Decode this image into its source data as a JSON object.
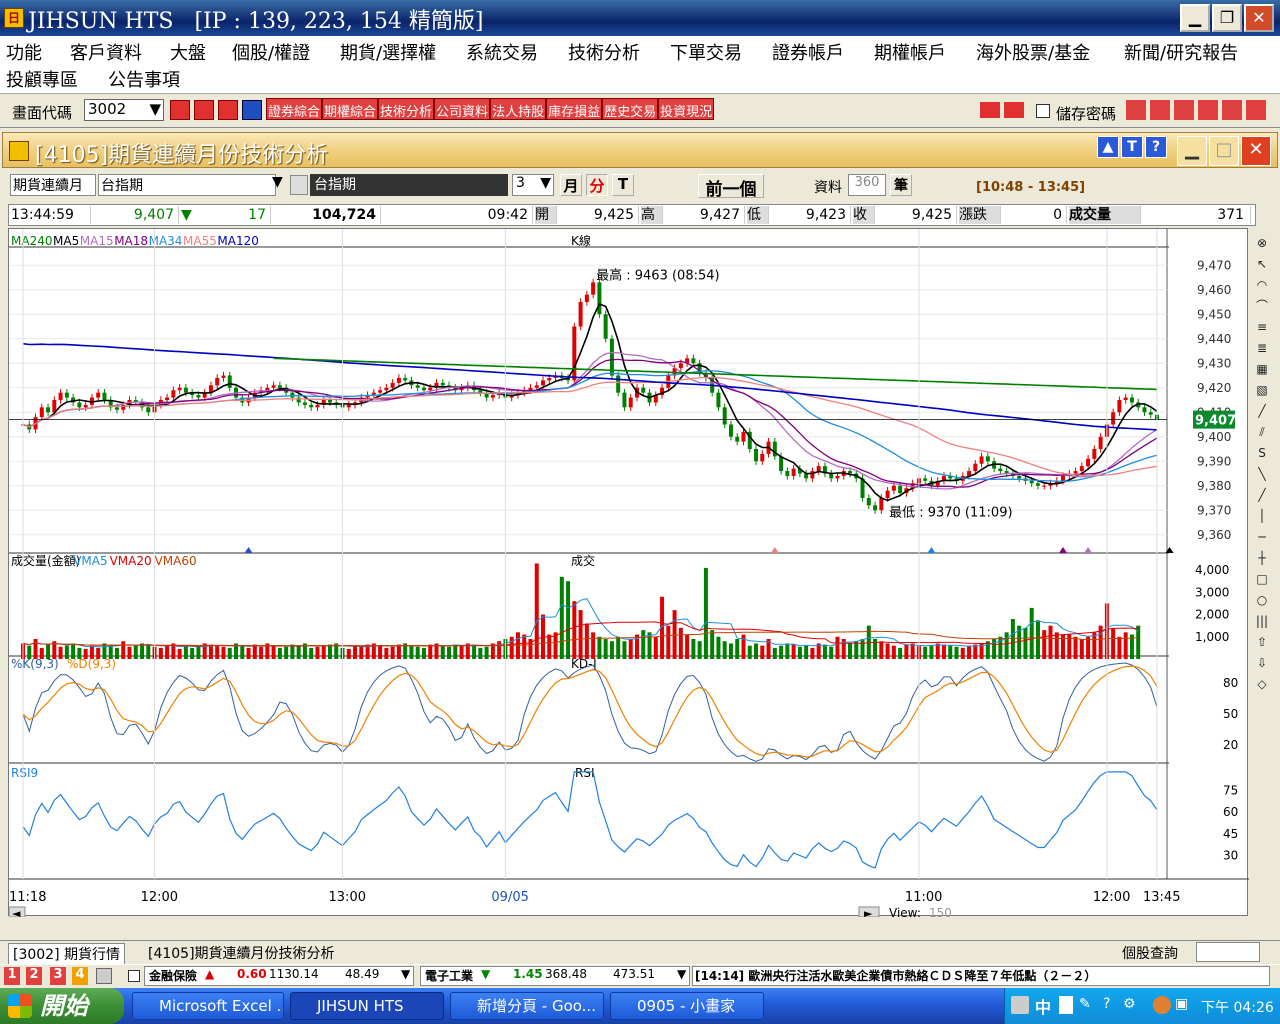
{
  "window": {
    "title": "JIHSUN HTS",
    "ip": "[IP : 139, 223, 154 精簡版]",
    "minimize": "▁",
    "maximize": "❐",
    "close": "✕"
  },
  "menu": {
    "row1": [
      "功能",
      "客戶資料",
      "大盤",
      "個股/權證",
      "期貨/選擇權",
      "系統交易",
      "技術分析",
      "下單交易",
      "證券帳戶",
      "期權帳戶",
      "海外股票/基金",
      "新聞/研究報告"
    ],
    "row2": [
      "投顧專區",
      "公告事項"
    ]
  },
  "toolbar": {
    "code_label": "畫面代碼",
    "code_value": "3002",
    "shortcuts": [
      "證券綜合",
      "期權綜合",
      "技術分析",
      "公司資料",
      "法人持股",
      "庫存損益",
      "歷史交易",
      "投資現況"
    ],
    "save_password_label": "儲存密碼"
  },
  "inner": {
    "caption": "[4105]期貨連續月份技術分析",
    "help_buttons": [
      "▲",
      "T",
      "?"
    ]
  },
  "controls": {
    "product_type": "期貨連續月",
    "product_name": "台指期",
    "selected_name": "台指期",
    "period_value": "3",
    "month_btn": "月",
    "minute_btn": "分",
    "tick_btn": "T",
    "prev_btn": "前一個",
    "data_label": "資料",
    "data_value": "360",
    "unit_label": "筆",
    "time_range": "[10:48 - 13:45]"
  },
  "quote": {
    "time": "13:44:59",
    "price": "9,407",
    "arrow": "▼",
    "change": "17",
    "volume_total": "104,724",
    "last_time": "09:42",
    "open_label": "開",
    "open": "9,425",
    "high_label": "高",
    "high": "9,427",
    "low_label": "低",
    "low": "9,423",
    "close_label": "收",
    "close": "9,425",
    "updown_label": "漲跌",
    "updown": "0",
    "vol_label": "成交量",
    "vol": "371"
  },
  "colors": {
    "up": "#e00000",
    "down": "#008000",
    "ma5": "#000000",
    "ma15": "#b070c0",
    "ma18": "#800080",
    "ma34": "#1e8fe0",
    "ma55": "#f08080",
    "ma120": "#0000c0",
    "ma240": "#008000",
    "k": "#3060a0",
    "d": "#f08000",
    "rsi": "#2080e0"
  },
  "chart_data": [
    {
      "type": "line",
      "title": "K線",
      "legend": [
        "MA240",
        "MA5",
        "MA15",
        "MA18",
        "MA34",
        "MA55",
        "MA120"
      ],
      "y_ticks": [
        9470,
        9460,
        9450,
        9440,
        9430,
        9420,
        9410,
        9400,
        9390,
        9380,
        9370,
        9360
      ],
      "ylim": [
        9355,
        9475
      ],
      "current_value": "9,407",
      "annotations": {
        "high": "最高 : 9463 (08:54)",
        "low": "最低 : 9370 (11:09)"
      },
      "close": [
        9405,
        9403,
        9408,
        9412,
        9410,
        9415,
        9418,
        9416,
        9414,
        9412,
        9413,
        9416,
        9418,
        9415,
        9412,
        9411,
        9413,
        9415,
        9414,
        9412,
        9410,
        9413,
        9415,
        9416,
        9419,
        9420,
        9418,
        9417,
        9416,
        9418,
        9421,
        9424,
        9425,
        9420,
        9416,
        9414,
        9416,
        9418,
        9419,
        9420,
        9421,
        9420,
        9418,
        9416,
        9414,
        9413,
        9412,
        9413,
        9415,
        9414,
        9413,
        9412,
        9413,
        9414,
        9416,
        9417,
        9418,
        9419,
        9420,
        9422,
        9424,
        9423,
        9421,
        9420,
        9419,
        9420,
        9422,
        9421,
        9420,
        9419,
        9420,
        9421,
        9419,
        9418,
        9416,
        9417,
        9418,
        9416,
        9417,
        9418,
        9419,
        9420,
        9421,
        9423,
        9424,
        9425,
        9424,
        9423,
        9445,
        9455,
        9458,
        9463,
        9450,
        9440,
        9425,
        9418,
        9412,
        9416,
        9420,
        9418,
        9414,
        9417,
        9420,
        9425,
        9428,
        9430,
        9432,
        9430,
        9426,
        9424,
        9418,
        9412,
        9405,
        9400,
        9398,
        9402,
        9395,
        9390,
        9393,
        9398,
        9392,
        9386,
        9384,
        9387,
        9385,
        9383,
        9386,
        9388,
        9385,
        9383,
        9384,
        9386,
        9385,
        9383,
        9375,
        9372,
        9370,
        9375,
        9378,
        9380,
        9377,
        9379,
        9381,
        9383,
        9382,
        9380,
        9382,
        9384,
        9383,
        9382,
        9384,
        9386,
        9389,
        9392,
        9390,
        9387,
        9386,
        9385,
        9384,
        9383,
        9382,
        9381,
        9380,
        9380,
        9381,
        9382,
        9384,
        9385,
        9386,
        9388,
        9391,
        9395,
        9400,
        9405,
        9410,
        9415,
        9416,
        9414,
        9412,
        9410,
        9409,
        9407
      ]
    },
    {
      "type": "bar",
      "title": "成交",
      "legend": [
        "成交量(金額)",
        "VMA5",
        "VMA20",
        "VMA60"
      ],
      "y_ticks": [
        4000,
        3000,
        2000,
        1000
      ],
      "ylim": [
        0,
        4500
      ],
      "values": [
        700,
        600,
        900,
        500,
        650,
        800,
        550,
        600,
        700,
        500,
        450,
        600,
        500,
        700,
        650,
        500,
        800,
        550,
        600,
        700,
        650,
        550,
        500,
        600,
        700,
        450,
        600,
        500,
        550,
        700,
        650,
        600,
        550,
        500,
        700,
        600,
        500,
        650,
        550,
        700,
        600,
        500,
        550,
        650,
        600,
        700,
        500,
        550,
        600,
        650,
        700,
        500,
        450,
        600,
        550,
        650,
        700,
        600,
        500,
        550,
        650,
        700,
        600,
        550,
        500,
        650,
        700,
        600,
        550,
        650,
        600,
        700,
        650,
        500,
        550,
        700,
        800,
        900,
        1000,
        1200,
        1100,
        900,
        4300,
        2000,
        1100,
        1200,
        3700,
        3500,
        2600,
        2200,
        1600,
        1200,
        1000,
        900,
        800,
        1000,
        800,
        900,
        1100,
        1300,
        1200,
        1000,
        2800,
        1500,
        2200,
        1400,
        1100,
        900,
        800,
        4100,
        1300,
        1000,
        800,
        700,
        900,
        1100,
        600,
        700,
        600,
        900,
        500,
        600,
        700,
        650,
        550,
        600,
        500,
        700,
        650,
        550,
        1000,
        900,
        700,
        800,
        900,
        1500,
        900,
        800,
        700,
        600,
        500,
        650,
        700,
        600,
        550,
        600,
        700,
        650,
        600,
        550,
        500,
        600,
        650,
        700,
        800,
        900,
        1000,
        1200,
        1800,
        1500,
        1400,
        2300,
        1700,
        1300,
        1500,
        1200,
        1100,
        1100,
        1000,
        900,
        1000,
        1200,
        1500,
        2500,
        1400,
        1000,
        1200,
        1100,
        1500
      ]
    },
    {
      "type": "line",
      "title": "KD-J",
      "legend": [
        "%K(9,3)",
        "%D(9,3)"
      ],
      "y_ticks": [
        80,
        50,
        20
      ],
      "ylim": [
        0,
        100
      ]
    },
    {
      "type": "line",
      "title": "RSI",
      "legend": [
        "RSI9"
      ],
      "y_ticks": [
        75,
        60,
        45,
        30
      ],
      "ylim": [
        15,
        90
      ]
    }
  ],
  "xaxis": {
    "labels": [
      "11:18",
      "12:00",
      "13:00",
      "09/05",
      "11:00",
      "12:00",
      "13:00",
      "13:45"
    ]
  },
  "scroll": {
    "view_label": "View:",
    "view_value": "150",
    "left": "◄",
    "right": "►"
  },
  "tabs": {
    "tab1": "[3002] 期貨行情",
    "tab2": "[4105]期貨連續月份技術分析",
    "stock_query": "個股查詢"
  },
  "ticker": {
    "nums": [
      "1",
      "2",
      "3",
      "4"
    ],
    "item1_name": "金融保險",
    "item1_arrow": "▲",
    "item1_chg": "0.60",
    "item1_price": "1130.14",
    "item1_vol": "48.49",
    "item2_name": "電子工業",
    "item2_arrow": "▼",
    "item2_chg": "1.45",
    "item2_price": "368.48",
    "item2_vol": "473.51",
    "news": "[14:14] 歐洲央行注活水歐美企業債市熱絡ＣＤＳ降至７年低點（２－２）"
  },
  "taskbar": {
    "start": "開始",
    "tasks": [
      "Microsoft Excel ...",
      "JIHSUN HTS",
      "新增分頁 - Goo...",
      "0905 - 小畫家"
    ],
    "ime": "中",
    "clock": "下午 04:26"
  }
}
